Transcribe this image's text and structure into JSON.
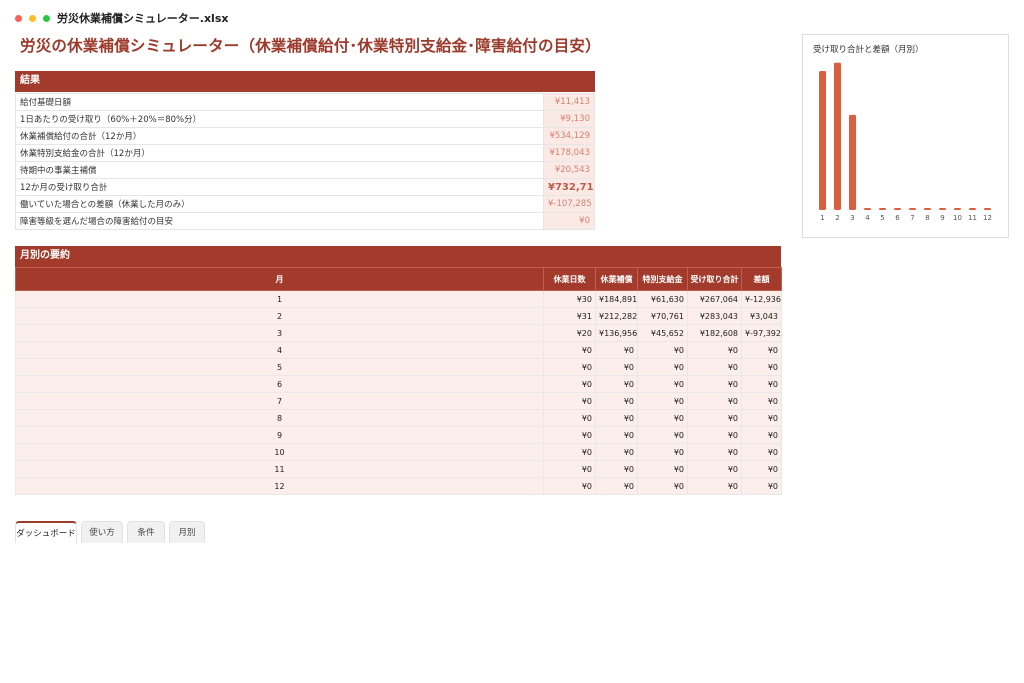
{
  "window": {
    "filename": "労災休業補償シミュレーター.xlsx"
  },
  "page": {
    "title": "労災の休業補償シミュレーター（休業補償給付･休業特別支給金･障害給付の目安）"
  },
  "results": {
    "heading": "結果",
    "rows": [
      {
        "label": "給付基礎日額",
        "value": "¥11,413"
      },
      {
        "label": "1日あたりの受け取り（60%＋20%＝80%分）",
        "value": "¥9,130"
      },
      {
        "label": "休業補償給付の合計（12か月）",
        "value": "¥534,129"
      },
      {
        "label": "休業特別支給金の合計（12か月）",
        "value": "¥178,043"
      },
      {
        "label": "待期中の事業主補償",
        "value": "¥20,543"
      },
      {
        "label": "12か月の受け取り合計",
        "value": "¥732,715"
      },
      {
        "label": "働いていた場合との差額（休業した月のみ）",
        "value": "¥-107,285"
      },
      {
        "label": "障害等級を選んだ場合の障害給付の目安",
        "value": "¥0"
      }
    ]
  },
  "monthly": {
    "heading": "月別の要約",
    "columns": [
      "月",
      "休業日数",
      "休業補償",
      "特別支給金",
      "受け取り合計",
      "差額"
    ],
    "rows": [
      [
        "1",
        "¥30",
        "¥184,891",
        "¥61,630",
        "¥267,064",
        "¥-12,936"
      ],
      [
        "2",
        "¥31",
        "¥212,282",
        "¥70,761",
        "¥283,043",
        "¥3,043"
      ],
      [
        "3",
        "¥20",
        "¥136,956",
        "¥45,652",
        "¥182,608",
        "¥-97,392"
      ],
      [
        "4",
        "¥0",
        "¥0",
        "¥0",
        "¥0",
        "¥0"
      ],
      [
        "5",
        "¥0",
        "¥0",
        "¥0",
        "¥0",
        "¥0"
      ],
      [
        "6",
        "¥0",
        "¥0",
        "¥0",
        "¥0",
        "¥0"
      ],
      [
        "7",
        "¥0",
        "¥0",
        "¥0",
        "¥0",
        "¥0"
      ],
      [
        "8",
        "¥0",
        "¥0",
        "¥0",
        "¥0",
        "¥0"
      ],
      [
        "9",
        "¥0",
        "¥0",
        "¥0",
        "¥0",
        "¥0"
      ],
      [
        "10",
        "¥0",
        "¥0",
        "¥0",
        "¥0",
        "¥0"
      ],
      [
        "11",
        "¥0",
        "¥0",
        "¥0",
        "¥0",
        "¥0"
      ],
      [
        "12",
        "¥0",
        "¥0",
        "¥0",
        "¥0",
        "¥0"
      ]
    ]
  },
  "chart_data": {
    "type": "bar",
    "title": "受け取り合計と差額（月別）",
    "categories": [
      "1",
      "2",
      "3",
      "4",
      "5",
      "6",
      "7",
      "8",
      "9",
      "10",
      "11",
      "12"
    ],
    "values": [
      267064,
      283043,
      182608,
      0,
      0,
      0,
      0,
      0,
      0,
      0,
      0,
      0
    ],
    "color": "#d9603f",
    "ylim": [
      0,
      290000
    ],
    "grid": false
  },
  "tabs": [
    {
      "label": "ダッシュボード",
      "active": true
    },
    {
      "label": "使い方",
      "active": false
    },
    {
      "label": "条件",
      "active": false
    },
    {
      "label": "月別",
      "active": false
    }
  ],
  "colors": {
    "accent": "#a33b2c",
    "title": "#9c3a2b",
    "bar": "#d9603f",
    "cell_fill": "#fbeeeb"
  }
}
